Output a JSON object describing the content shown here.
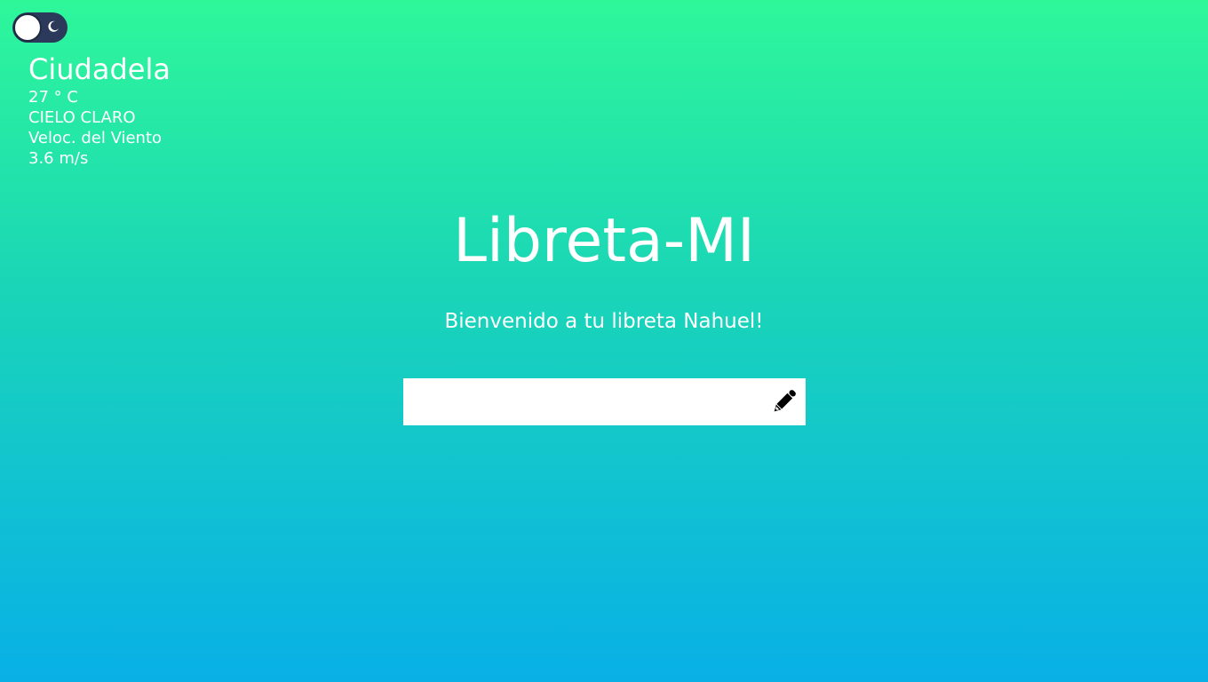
{
  "theme_toggle": {
    "state": "light",
    "icon": "moon-icon"
  },
  "weather": {
    "city": "Ciudadela",
    "temperature": "27 ° C",
    "condition": "CIELO CLARO",
    "wind_label": "Veloc. del Viento",
    "wind_speed": "3.6 m/s"
  },
  "main": {
    "title": "Libreta-MI",
    "welcome": "Bienvenido a tu libreta Nahuel!"
  },
  "note_input": {
    "value": "",
    "placeholder": "",
    "icon": "pencil-icon"
  },
  "colors": {
    "gradient_top": "#2ef79a",
    "gradient_bottom": "#08b0e6",
    "toggle_bg": "#2b3a5a"
  }
}
